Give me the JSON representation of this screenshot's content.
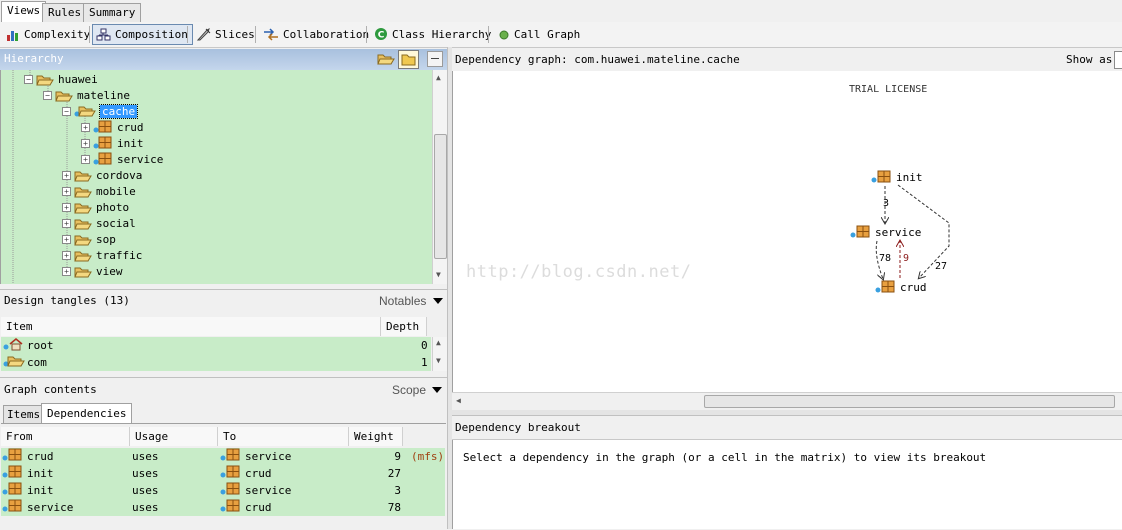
{
  "top_tabs": [
    "Views",
    "Rules",
    "Summary"
  ],
  "toolbar": {
    "complexity": "Complexity",
    "composition": "Composition",
    "slices": "Slices",
    "collaboration": "Collaboration",
    "class_hierarchy": "Class Hierarchy",
    "call_graph": "Call Graph"
  },
  "hierarchy": {
    "title": "Hierarchy",
    "nodes": {
      "huawei": "huawei",
      "mateline": "mateline",
      "cache": "cache",
      "crud": "crud",
      "init": "init",
      "service": "service",
      "cordova": "cordova",
      "mobile": "mobile",
      "photo": "photo",
      "social": "social",
      "sop": "sop",
      "traffic": "traffic",
      "view": "view"
    }
  },
  "tangles": {
    "title": "Design tangles (13)",
    "dropdown": "Notables",
    "col_item": "Item",
    "col_depth": "Depth",
    "rows": [
      {
        "item": "root",
        "depth": "0"
      },
      {
        "item": "com",
        "depth": "1"
      }
    ]
  },
  "graph_contents": {
    "title": "Graph contents",
    "dropdown": "Scope",
    "tab_items": "Items",
    "tab_dependencies": "Dependencies",
    "cols": {
      "from": "From",
      "usage": "Usage",
      "to": "To",
      "weight": "Weight"
    },
    "rows": [
      {
        "from": "crud",
        "usage": "uses",
        "to": "service",
        "weight": "9",
        "note": "(mfs)"
      },
      {
        "from": "init",
        "usage": "uses",
        "to": "crud",
        "weight": "27",
        "note": ""
      },
      {
        "from": "init",
        "usage": "uses",
        "to": "service",
        "weight": "3",
        "note": ""
      },
      {
        "from": "service",
        "usage": "uses",
        "to": "crud",
        "weight": "78",
        "note": ""
      }
    ]
  },
  "graph": {
    "header": "Dependency graph: com.huawei.mateline.cache",
    "show_as": "Show as",
    "license": "TRIAL LICENSE",
    "watermark": "http://blog.csdn.net/",
    "nodes": {
      "init": "init",
      "service": "service",
      "crud": "crud"
    },
    "edges": {
      "init_service": "3",
      "service_crud": "78",
      "crud_service": "9",
      "init_crud": "27"
    }
  },
  "breakout": {
    "title": "Dependency breakout",
    "message": "Select a dependency in the graph (or a cell in the matrix) to view its breakout"
  },
  "colors": {
    "green_bg": "#c8ecc8",
    "selection": "#3399ff",
    "cycle_edge": "#8b1a1a"
  }
}
